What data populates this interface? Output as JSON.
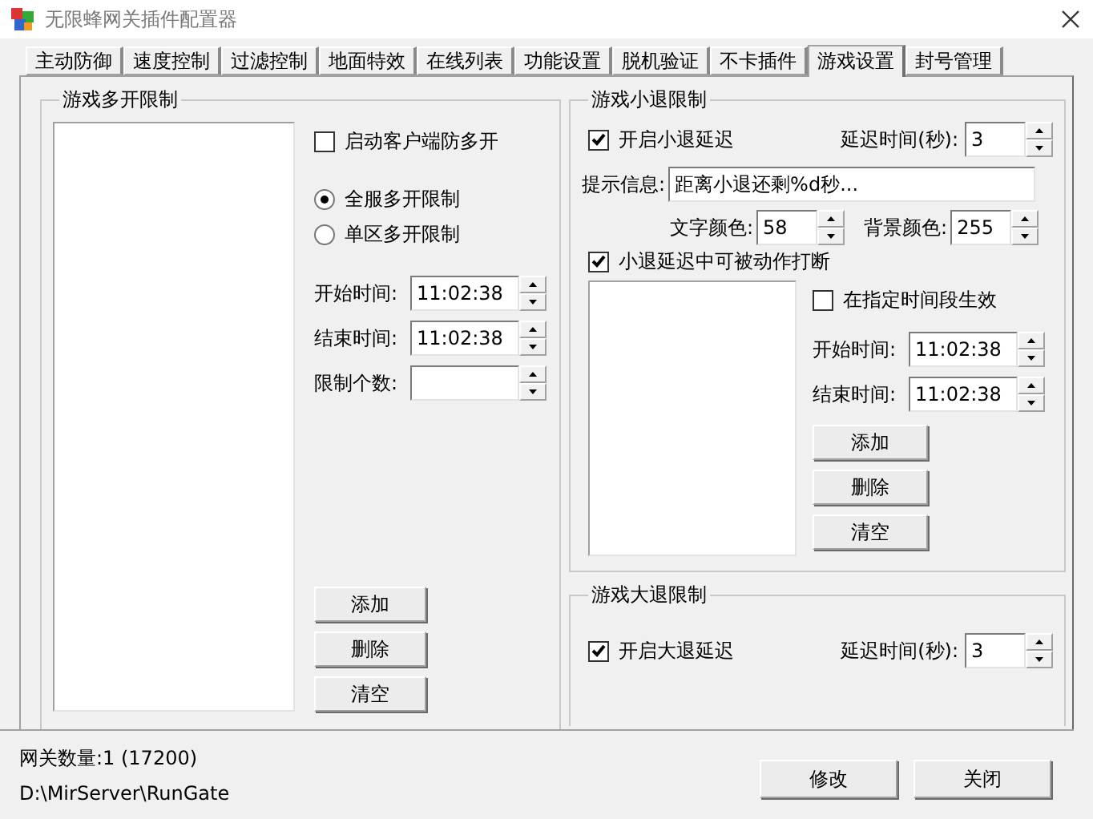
{
  "window": {
    "title": "无限蜂网关插件配置器"
  },
  "tabs": [
    {
      "label": "主动防御",
      "selected": false
    },
    {
      "label": "速度控制",
      "selected": false
    },
    {
      "label": "过滤控制",
      "selected": false
    },
    {
      "label": "地面特效",
      "selected": false
    },
    {
      "label": "在线列表",
      "selected": false
    },
    {
      "label": "功能设置",
      "selected": false
    },
    {
      "label": "脱机验证",
      "selected": false
    },
    {
      "label": "不卡插件",
      "selected": false
    },
    {
      "label": "游戏设置",
      "selected": true
    },
    {
      "label": "封号管理",
      "selected": false
    }
  ],
  "multi_open_group": {
    "title": "游戏多开限制",
    "client_check": {
      "label": "启动客户端防多开",
      "checked": false
    },
    "radios": [
      {
        "label": "全服多开限制",
        "selected": true
      },
      {
        "label": "单区多开限制",
        "selected": false
      }
    ],
    "start_time": {
      "label": "开始时间:",
      "value": "11:02:38"
    },
    "end_time": {
      "label": "结束时间:",
      "value": "11:02:38"
    },
    "limit_count": {
      "label": "限制个数:"
    },
    "buttons": [
      "添加",
      "删除",
      "清空"
    ]
  },
  "small_logout_group": {
    "title": "游戏小退限制",
    "enable": {
      "label": "开启小退延迟",
      "checked": true
    },
    "delay": {
      "label": "延迟时间(秒):",
      "value": "3"
    },
    "hint": {
      "label": "提示信息:",
      "value": "距离小退还剩%d秒..."
    },
    "text_color": {
      "label": "文字颜色:",
      "value": "58"
    },
    "bg_color": {
      "label": "背景颜色:",
      "value": "255"
    },
    "interrupt": {
      "label": "小退延迟中可被动作打断",
      "checked": true
    },
    "period": {
      "label": "在指定时间段生效",
      "checked": false
    },
    "start_time": {
      "label": "开始时间:",
      "value": "11:02:38"
    },
    "end_time": {
      "label": "结束时间:",
      "value": "11:02:38"
    },
    "buttons": [
      "添加",
      "删除",
      "清空"
    ]
  },
  "big_logout_group": {
    "title": "游戏大退限制",
    "enable": {
      "label": "开启大退延迟",
      "checked": true
    },
    "delay": {
      "label": "延迟时间(秒):",
      "value": "3"
    }
  },
  "status": {
    "gateway_count": "网关数量:1 (17200)",
    "path": "D:\\MirServer\\RunGate"
  },
  "buttons": [
    "修改",
    "关闭"
  ]
}
